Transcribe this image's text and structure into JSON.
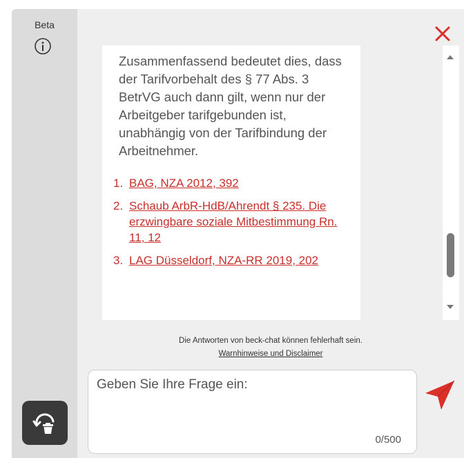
{
  "sidebar": {
    "badge_label": "Beta",
    "info_icon": "info-circle-icon",
    "reset_icon": "chat-reset-trash-icon"
  },
  "header": {
    "close_icon": "close-x-icon"
  },
  "message": {
    "text": "Zusammenfassend bedeutet dies, dass der Tarifvorbehalt des § 77 Abs. 3 BetrVG auch dann gilt, wenn nur der Arbeitgeber tarifgebunden ist, unabhängig von der Tarifbindung der Arbeitnehmer.",
    "sources": [
      {
        "num": "1.",
        "label": "BAG, NZA 2012, 392"
      },
      {
        "num": "2.",
        "label": "Schaub ArbR-HdB/Ahrendt § 235. Die erzwingbare soziale Mitbestimmung Rn. 11, 12"
      },
      {
        "num": "3.",
        "label": "LAG Düsseldorf, NZA-RR 2019, 202"
      }
    ]
  },
  "disclaimer": {
    "text": "Die Antworten von beck-chat können fehlerhaft sein.",
    "link": "Warnhinweise und Disclaimer"
  },
  "input": {
    "placeholder": "Geben Sie Ihre Frage ein:",
    "value": "",
    "char_count": "0/500"
  },
  "send_icon": "send-paper-plane-icon",
  "colors": {
    "accent": "#d9302a",
    "link": "#c8302c",
    "sidebar_bg": "#dcdcdc",
    "panel_bg": "#efefef",
    "reset_button_bg": "#3a3a3a"
  }
}
